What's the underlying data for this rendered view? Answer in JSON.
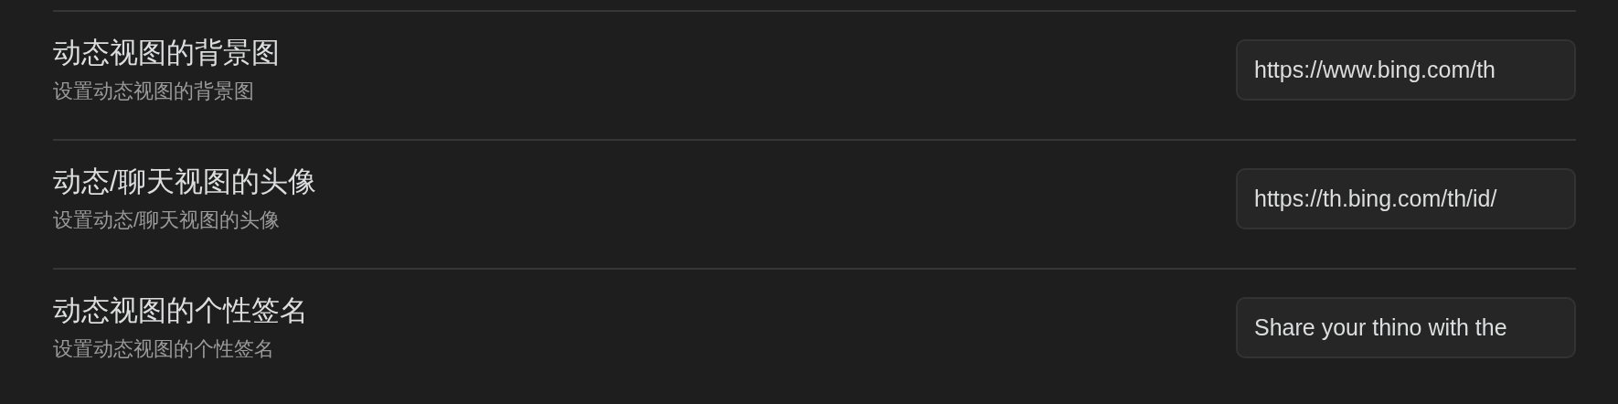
{
  "settings": [
    {
      "name": "动态视图的背景图",
      "description": "设置动态视图的背景图",
      "value": "https://www.bing.com/th"
    },
    {
      "name": "动态/聊天视图的头像",
      "description": "设置动态/聊天视图的头像",
      "value": "https://th.bing.com/th/id/"
    },
    {
      "name": "动态视图的个性签名",
      "description": "设置动态视图的个性签名",
      "value": "Share your thino with the"
    }
  ]
}
